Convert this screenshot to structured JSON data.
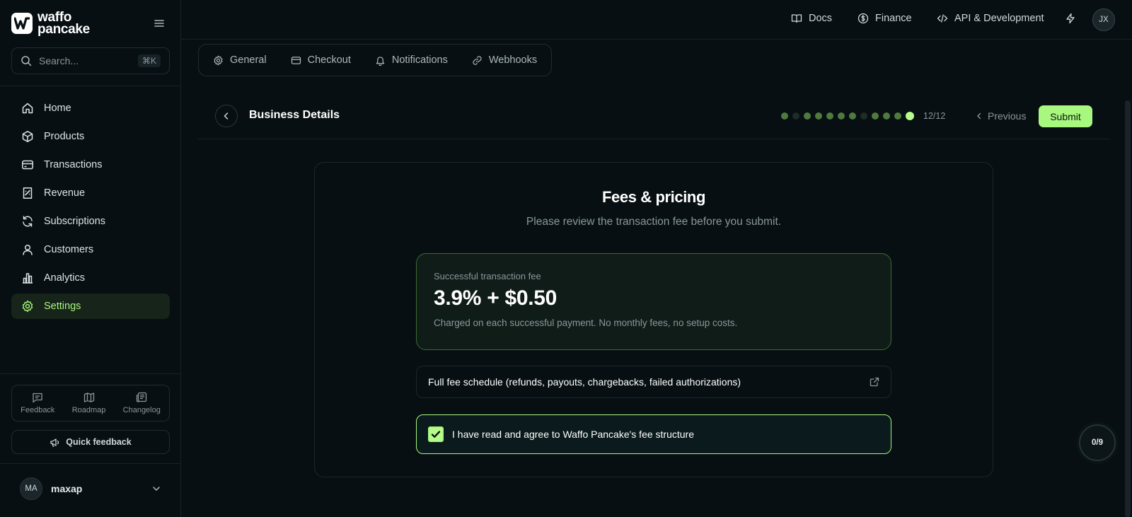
{
  "brand": {
    "line1": "waffo",
    "line2": "pancake"
  },
  "search": {
    "placeholder": "Search...",
    "shortcut": "⌘K"
  },
  "nav": [
    {
      "label": "Home",
      "icon": "home-icon"
    },
    {
      "label": "Products",
      "icon": "box-icon"
    },
    {
      "label": "Transactions",
      "icon": "credit-card-icon"
    },
    {
      "label": "Revenue",
      "icon": "receipt-icon"
    },
    {
      "label": "Subscriptions",
      "icon": "refresh-icon"
    },
    {
      "label": "Customers",
      "icon": "user-icon"
    },
    {
      "label": "Analytics",
      "icon": "bar-chart-icon"
    },
    {
      "label": "Settings",
      "icon": "gear-icon",
      "active": true
    }
  ],
  "bottom_links": [
    {
      "label": "Feedback",
      "icon": "message-icon"
    },
    {
      "label": "Roadmap",
      "icon": "map-icon"
    },
    {
      "label": "Changelog",
      "icon": "newspaper-icon"
    }
  ],
  "quick_feedback": "Quick feedback",
  "user": {
    "initials": "MA",
    "name": "maxap"
  },
  "topbar": {
    "links": [
      {
        "label": "Docs",
        "icon": "book-icon"
      },
      {
        "label": "Finance",
        "icon": "dollar-circle-icon"
      },
      {
        "label": "API & Development",
        "icon": "code-icon"
      }
    ],
    "avatar": "JX"
  },
  "tabs": [
    {
      "label": "General",
      "icon": "gear-icon"
    },
    {
      "label": "Checkout",
      "icon": "credit-card-icon"
    },
    {
      "label": "Notifications",
      "icon": "bell-icon"
    },
    {
      "label": "Webhooks",
      "icon": "link-icon"
    }
  ],
  "header": {
    "title": "Business Details",
    "step_count": "12/12",
    "steps": [
      "done",
      "dim",
      "done",
      "done",
      "done",
      "done",
      "done",
      "dim",
      "done",
      "done",
      "done",
      "current"
    ],
    "previous": "Previous",
    "submit": "Submit"
  },
  "card": {
    "title": "Fees & pricing",
    "subtitle": "Please review the transaction fee before you submit.",
    "fee_label": "Successful transaction fee",
    "fee_value": "3.9% + $0.50",
    "fee_note": "Charged on each successful payment. No monthly fees, no setup costs.",
    "schedule_label": "Full fee schedule (refunds, payouts, chargebacks, failed authorizations)",
    "agree_label": "I have read and agree to Waffo Pancake's fee structure",
    "agree_checked": true
  },
  "progress": "0/9",
  "colors": {
    "accent": "#a8f77e",
    "background": "#070f12",
    "border": "#1c272c"
  }
}
